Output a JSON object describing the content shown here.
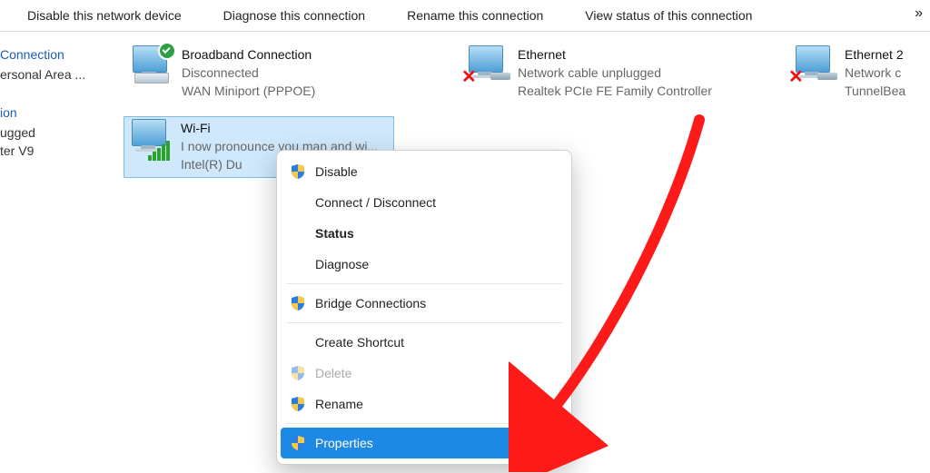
{
  "toolbar": {
    "disable": "Disable this network device",
    "diagnose": "Diagnose this connection",
    "rename": "Rename this connection",
    "viewstatus": "View status of this connection",
    "more": "»"
  },
  "sidebar": {
    "heading": "Connection",
    "l1": "ersonal Area ...",
    "tion": "ion",
    "ugged": "ugged",
    "v9": "ter V9"
  },
  "tiles": {
    "broadband": {
      "name": "Broadband Connection",
      "sub": "Disconnected",
      "dev": "WAN Miniport (PPPOE)"
    },
    "ethernet": {
      "name": "Ethernet",
      "sub": "Network cable unplugged",
      "dev": "Realtek PCIe FE Family Controller"
    },
    "ethernet2": {
      "name": "Ethernet 2",
      "sub": "Network c",
      "dev": "TunnelBea"
    },
    "wifi": {
      "name": "Wi-Fi",
      "sub": "I now pronounce vou man and wi...",
      "dev": "Intel(R) Du"
    }
  },
  "menu": {
    "disable": "Disable",
    "connect": "Connect / Disconnect",
    "status": "Status",
    "diagnose": "Diagnose",
    "bridge": "Bridge Connections",
    "shortcut": "Create Shortcut",
    "delete": "Delete",
    "rename": "Rename",
    "properties": "Properties"
  }
}
